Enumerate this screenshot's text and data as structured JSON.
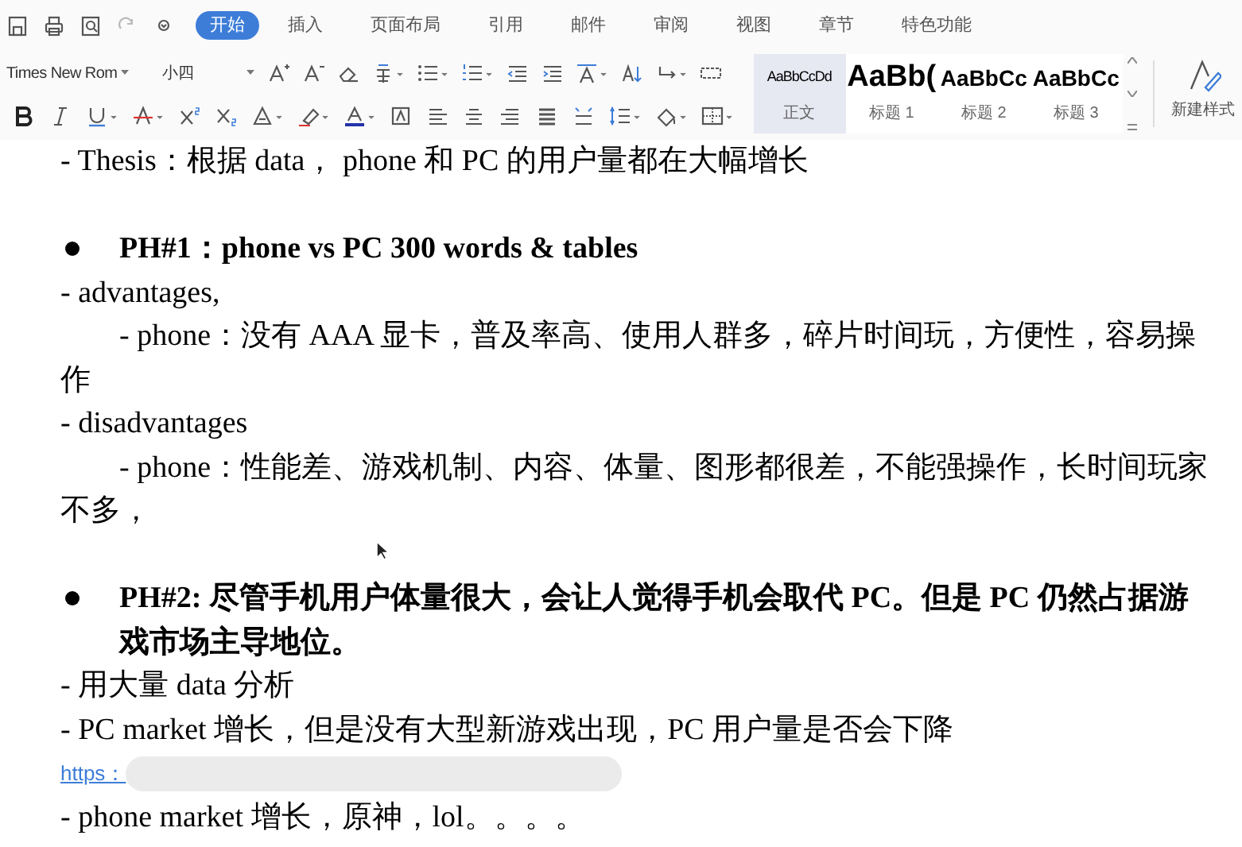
{
  "tabs": [
    {
      "label": "开始",
      "selected": true
    },
    {
      "label": "插入",
      "selected": false
    },
    {
      "label": "页面布局",
      "selected": false
    },
    {
      "label": "引用",
      "selected": false
    },
    {
      "label": "邮件",
      "selected": false
    },
    {
      "label": "审阅",
      "selected": false
    },
    {
      "label": "视图",
      "selected": false
    },
    {
      "label": "章节",
      "selected": false
    },
    {
      "label": "特色功能",
      "selected": false
    }
  ],
  "toolbar": {
    "font_name": "Times New Rom",
    "font_size": "小四"
  },
  "styles": [
    {
      "sample": "AaBbCcDd",
      "label": "正文",
      "selected": true
    },
    {
      "sample": "AaBb(",
      "label": "标题 1",
      "selected": false
    },
    {
      "sample": "AaBbCc",
      "label": "标题 2",
      "selected": false
    },
    {
      "sample": "AaBbCc",
      "label": "标题 3",
      "selected": false
    }
  ],
  "new_style": "新建样式",
  "document": [
    {
      "kind": "line",
      "text": "- Thesis：根据 data，  phone 和 PC 的用户量都在大幅增长"
    },
    {
      "kind": "blank"
    },
    {
      "kind": "bullet",
      "text": "PH#1：phone vs PC 300 words & tables"
    },
    {
      "kind": "line",
      "text": "- advantages,"
    },
    {
      "kind": "indent",
      "text": "- phone：没有 AAA 显卡，普及率高、使用人群多，碎片时间玩，方便性，容易操作"
    },
    {
      "kind": "line",
      "text": "- disadvantages"
    },
    {
      "kind": "indent",
      "text": "- phone：性能差、游戏机制、内容、体量、图形都很差，不能强操作，长时间玩家不多，"
    },
    {
      "kind": "blank"
    },
    {
      "kind": "bullet",
      "text": "PH#2: 尽管手机用户体量很大，会让人觉得手机会取代 PC。但是 PC 仍然占据游戏市场主导地位。"
    },
    {
      "kind": "line",
      "text": "-  用大量 data 分析"
    },
    {
      "kind": "line",
      "text": "- PC market 增长，但是没有大型新游戏出现，PC 用户量是否会下降"
    },
    {
      "kind": "link",
      "text": "https："
    },
    {
      "kind": "line",
      "text": "- phone market 增长，原神，lol。。。。"
    }
  ]
}
